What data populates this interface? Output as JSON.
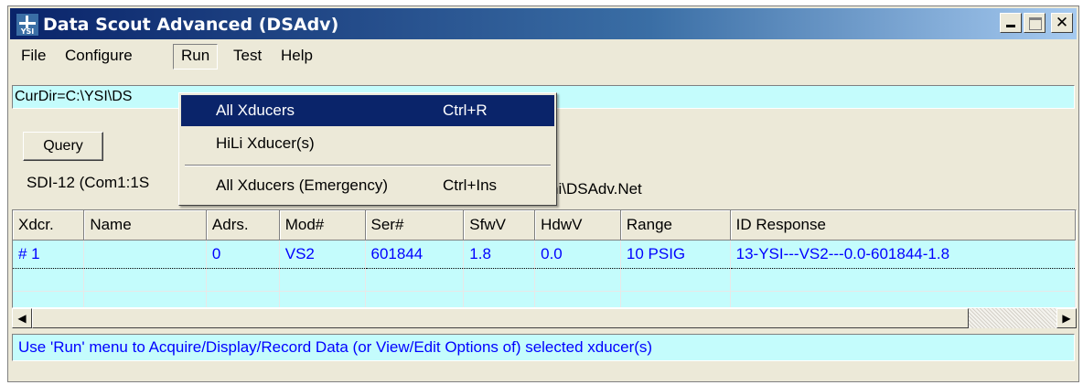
{
  "window": {
    "title": "Data Scout Advanced (DSAdv)",
    "icon": "ysi-app-icon",
    "icon_text": "YSI",
    "controls": [
      "minimize",
      "maximize",
      "close"
    ]
  },
  "menubar": {
    "items": [
      "File",
      "Configure",
      "Run",
      "Test",
      "Help"
    ],
    "open": "Run"
  },
  "run_menu": {
    "items": [
      {
        "label": "All Xducers",
        "shortcut": "Ctrl+R",
        "highlighted": true
      },
      {
        "label": "HiLi Xducer(s)",
        "shortcut": ""
      },
      {
        "label": "All Xducers (Emergency)",
        "shortcut": "Ctrl+Ins"
      }
    ]
  },
  "curdir": {
    "text": "CurDir=C:\\YSI\\DS"
  },
  "query_button": {
    "label": "Query"
  },
  "port_info": {
    "left_text": "SDI-12 (Com1:1S",
    "right_text": "ni\\DSAdv.Net"
  },
  "grid": {
    "columns": [
      "Xdcr.",
      "Name",
      "Adrs.",
      "Mod#",
      "Ser#",
      "SfwV",
      "HdwV",
      "Range",
      "ID Response"
    ],
    "rows": [
      [
        "# 1",
        "",
        "0",
        "VS2",
        "601844",
        "1.8",
        "0.0",
        "10 PSIG",
        "13-YSI---VS2---0.0-601844-1.8"
      ]
    ]
  },
  "status": {
    "text": "Use 'Run' menu to Acquire/Display/Record Data (or View/Edit Options of) selected xducer(s)"
  },
  "colors": {
    "title_bar": "#0a246a",
    "highlight": "#0a246a",
    "field_bg": "#c4fcfc",
    "grid_text": "#0000ff",
    "face": "#ece9d8"
  }
}
